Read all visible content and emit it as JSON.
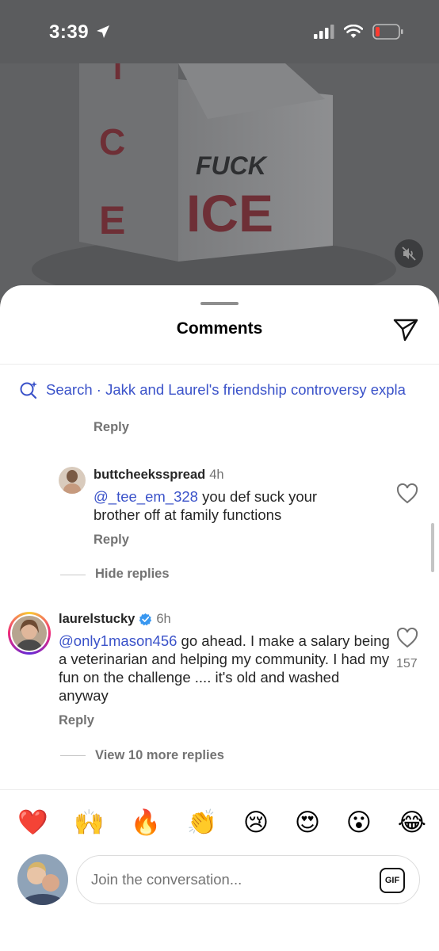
{
  "status_bar": {
    "time": "3:39"
  },
  "media": {
    "headline_art_text": "FUCK ICE"
  },
  "sheet": {
    "title": "Comments"
  },
  "search": {
    "prefix": "Search",
    "query": "Jakk and Laurel's friendship controversy expla"
  },
  "top_reply_label": "Reply",
  "comments": [
    {
      "username": "buttcheeksspread",
      "time": "4h",
      "mention": "@_tee_em_328",
      "text": "you def suck your brother off at family functions",
      "reply_label": "Reply"
    },
    {
      "username": "laurelstucky",
      "verified": true,
      "time": "6h",
      "mention": "@only1mason456",
      "text": "go ahead. I make a salary being a veterinarian and helping my community. I had my fun on the challenge .... it's old and washed anyway",
      "reply_label": "Reply",
      "likes": "157"
    }
  ],
  "hide_replies_label": "Hide replies",
  "view_more_label": "View 10 more replies",
  "emojis": [
    "❤️",
    "🙌",
    "🔥",
    "👏",
    "😢",
    "😍",
    "😮",
    "😂"
  ],
  "composer": {
    "placeholder": "Join the conversation...",
    "gif_label": "GIF"
  },
  "colors": {
    "link": "#3a52c9",
    "muted": "#737373",
    "verified": "#3897f0"
  }
}
